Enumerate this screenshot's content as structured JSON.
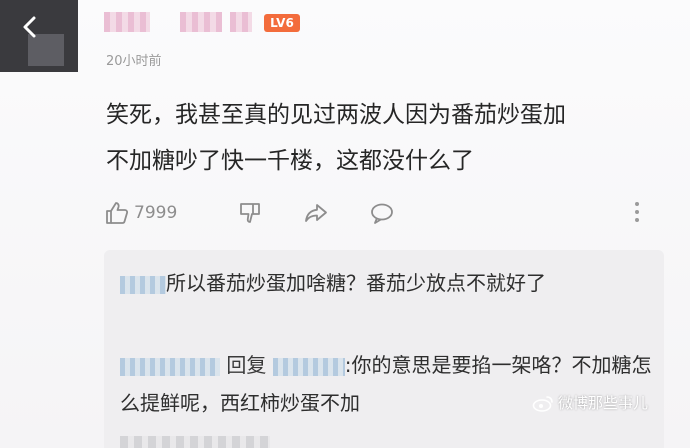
{
  "post": {
    "level_badge": "LV6",
    "timestamp": "20小时前",
    "comment_lines": [
      "笑死，我甚至真的见过两波人因为番茄炒蛋加",
      "不加糖吵了快一千楼，这都没什么了"
    ],
    "like_count": "7999"
  },
  "replies": [
    {
      "text": "所以番茄炒蛋加啥糖？番茄少放点不就好了"
    },
    {
      "reply_word": "回复",
      "text": ":你的意思是要掐一架咯？不加糖怎么提鲜呢，西红柿炒蛋不加"
    }
  ],
  "watermark": {
    "text": "微博那些事儿"
  },
  "icons": [
    "back-icon",
    "thumbs-up-icon",
    "thumbs-down-icon",
    "share-icon",
    "comment-icon",
    "more-icon",
    "weibo-logo-icon"
  ],
  "colors": {
    "level_badge_bg": "#f36c3c",
    "text_primary": "#262626",
    "text_secondary": "#9a9a9a",
    "reply_bg": "#efeef0"
  }
}
